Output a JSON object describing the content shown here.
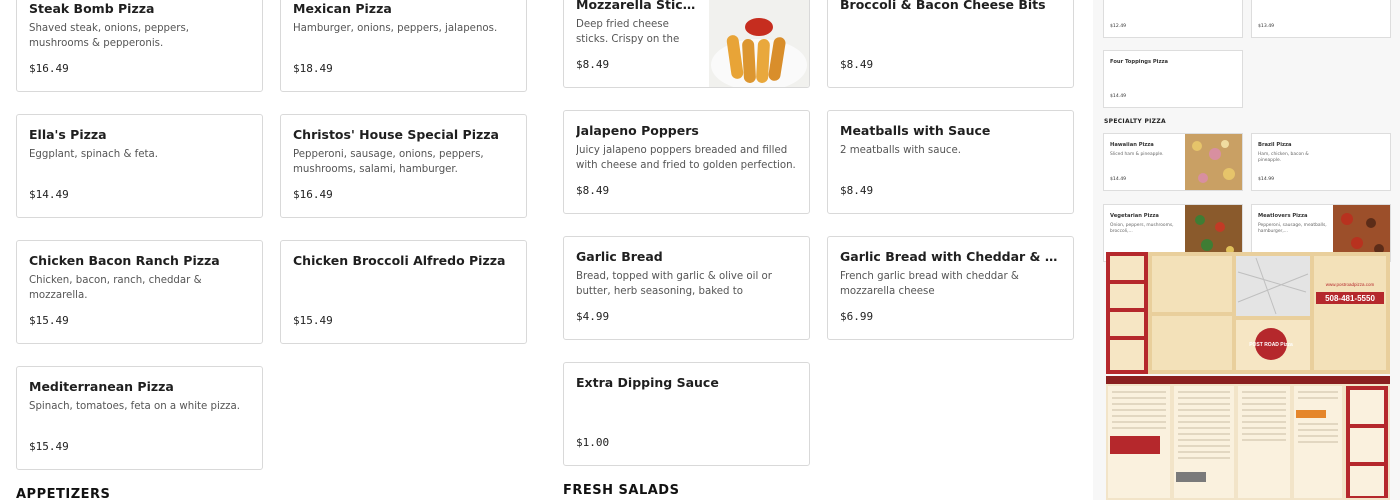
{
  "col1": {
    "cards": [
      {
        "name": "Steak Bomb Pizza",
        "desc": "Shaved steak, onions, peppers, mushrooms & pepperonis.",
        "price": "$16.49"
      },
      {
        "name": "Ella's Pizza",
        "desc": "Eggplant, spinach & feta.",
        "price": "$14.49"
      },
      {
        "name": "Chicken Bacon Ranch Pizza",
        "desc": "Chicken, bacon, ranch, cheddar & mozzarella.",
        "price": "$15.49"
      },
      {
        "name": "Mediterranean Pizza",
        "desc": "Spinach, tomatoes, feta on a white pizza.",
        "price": "$15.49"
      }
    ],
    "section_heading": "APPETIZERS"
  },
  "col2": {
    "cards": [
      {
        "name": "Mexican Pizza",
        "desc": "Hamburger, onions, peppers, jalapenos.",
        "price": "$18.49"
      },
      {
        "name": "Christos' House Special Pizza",
        "desc": "Pepperoni, sausage, onions, peppers, mushrooms, salami, hamburger.",
        "price": "$16.49"
      },
      {
        "name": "Chicken Broccoli Alfredo Pizza",
        "desc": "",
        "price": "$15.49"
      }
    ]
  },
  "col3": {
    "cards": [
      {
        "name": "Mozzarella Sticks",
        "desc": "Deep fried cheese sticks. Crispy on the outside,...",
        "price": "$8.49",
        "image": "mozzarella-sticks-photo"
      },
      {
        "name": "Jalapeno Poppers",
        "desc": "Juicy jalapeno poppers breaded and filled with cheese and fried to golden perfection.",
        "price": "$8.49"
      },
      {
        "name": "Garlic Bread",
        "desc": "Bread, topped with garlic & olive oil or butter, herb seasoning, baked to perfection. Melts in your...",
        "price": "$4.99"
      },
      {
        "name": "Extra Dipping Sauce",
        "desc": "",
        "price": "$1.00"
      }
    ],
    "section_heading": "FRESH SALADS"
  },
  "col4": {
    "cards": [
      {
        "name": "Broccoli & Bacon Cheese Bits",
        "desc": "",
        "price": "$8.49"
      },
      {
        "name": "Meatballs with Sauce",
        "desc": "2 meatballs with sauce.",
        "price": "$8.49"
      },
      {
        "name": "Garlic Bread with Cheddar & Mozzarella...",
        "desc": "French garlic bread with cheddar & mozzarella cheese",
        "price": "$6.99"
      }
    ]
  },
  "flyer": {
    "top_prices": [
      "$12.49",
      "$13.49"
    ],
    "four_toppings": {
      "name": "Four Toppings Pizza",
      "price": "$14.49"
    },
    "specialty_heading": "SPECIALTY PIZZA",
    "minis": [
      {
        "name": "Hawaiian Pizza",
        "desc": "Sliced ham & pineapple.",
        "price": "$14.49"
      },
      {
        "name": "Brazil Pizza",
        "desc": "Ham, chicken, bacon & pineapple.",
        "price": "$14.99"
      },
      {
        "name": "Vegetarian Pizza",
        "desc": "Onion, peppers, mushrooms, broccoli,...",
        "price": ""
      },
      {
        "name": "Meatlovers Pizza",
        "desc": "Pepperoni, sausage, meatballs, hamburger,...",
        "price": ""
      }
    ],
    "menu_flyer_phone": "508-481-5550",
    "menu_flyer_site": "www.postroadpizza.com",
    "menu_flyer_brand": "POST ROAD Pizza",
    "colors": {
      "flyer_tan": "#e9cf9c",
      "flyer_red": "#b5282c",
      "flyer_orange": "#e5862b"
    }
  }
}
